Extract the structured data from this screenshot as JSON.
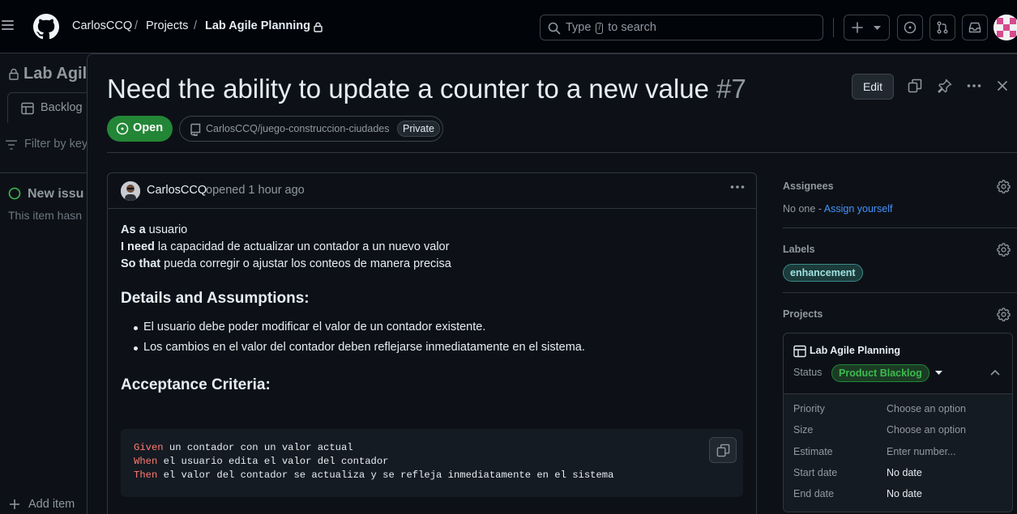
{
  "header": {
    "owner": "CarlosCCQ",
    "separator": "/",
    "projects": "Projects",
    "project_name": "Lab Agile Planning",
    "search_prefix": "Type",
    "search_key": "/",
    "search_suffix": "to search"
  },
  "background": {
    "project_title": "Lab Agil",
    "tab_label": "Backlog",
    "filter_placeholder": "Filter by key",
    "item_title": "New issu",
    "item_sub": "This item hasn",
    "add_item": "Add item"
  },
  "issue": {
    "title": "Need the ability to update a counter to a new value",
    "number": "#7",
    "edit_label": "Edit",
    "state": "Open",
    "repo": "CarlosCCQ/juego-construccion-ciudades",
    "visibility": "Private"
  },
  "comment": {
    "author": "CarlosCCQ",
    "meta": "opened 1 hour ago",
    "story": [
      {
        "strong": "As a",
        "text": " usuario"
      },
      {
        "strong": "I need",
        "text": " la capacidad de actualizar un contador a un nuevo valor"
      },
      {
        "strong": "So that",
        "text": " pueda corregir o ajustar los conteos de manera precisa"
      }
    ],
    "details_heading": "Details and Assumptions:",
    "details": [
      "El usuario debe poder modificar el valor de un contador existente.",
      "Los cambios en el valor del contador deben reflejarse inmediatamente en el sistema."
    ],
    "criteria_heading": "Acceptance Criteria:",
    "code": [
      {
        "kw": "Given",
        "text": " un contador con un valor actual"
      },
      {
        "kw": "When",
        "text": " el usuario edita el valor del contador"
      },
      {
        "kw": "Then",
        "text": " el valor del contador se actualiza y se refleja inmediatamente en el sistema"
      }
    ]
  },
  "sidebar": {
    "assignees_label": "Assignees",
    "assignees_none": "No one -",
    "assign_yourself": "Assign yourself",
    "labels_label": "Labels",
    "label": "enhancement",
    "projects_label": "Projects",
    "project": {
      "name": "Lab Agile Planning",
      "status_label": "Status",
      "status_value": "Product Blacklog",
      "fields": [
        {
          "name": "Priority",
          "value": "Choose an option",
          "set": false
        },
        {
          "name": "Size",
          "value": "Choose an option",
          "set": false
        },
        {
          "name": "Estimate",
          "value": "Enter number...",
          "set": false
        },
        {
          "name": "Start date",
          "value": "No date",
          "set": true
        },
        {
          "name": "End date",
          "value": "No date",
          "set": true
        }
      ]
    }
  },
  "colors": {
    "open_green": "#238636",
    "link_blue": "#4493f8",
    "code_keyword": "#ff7b72"
  }
}
